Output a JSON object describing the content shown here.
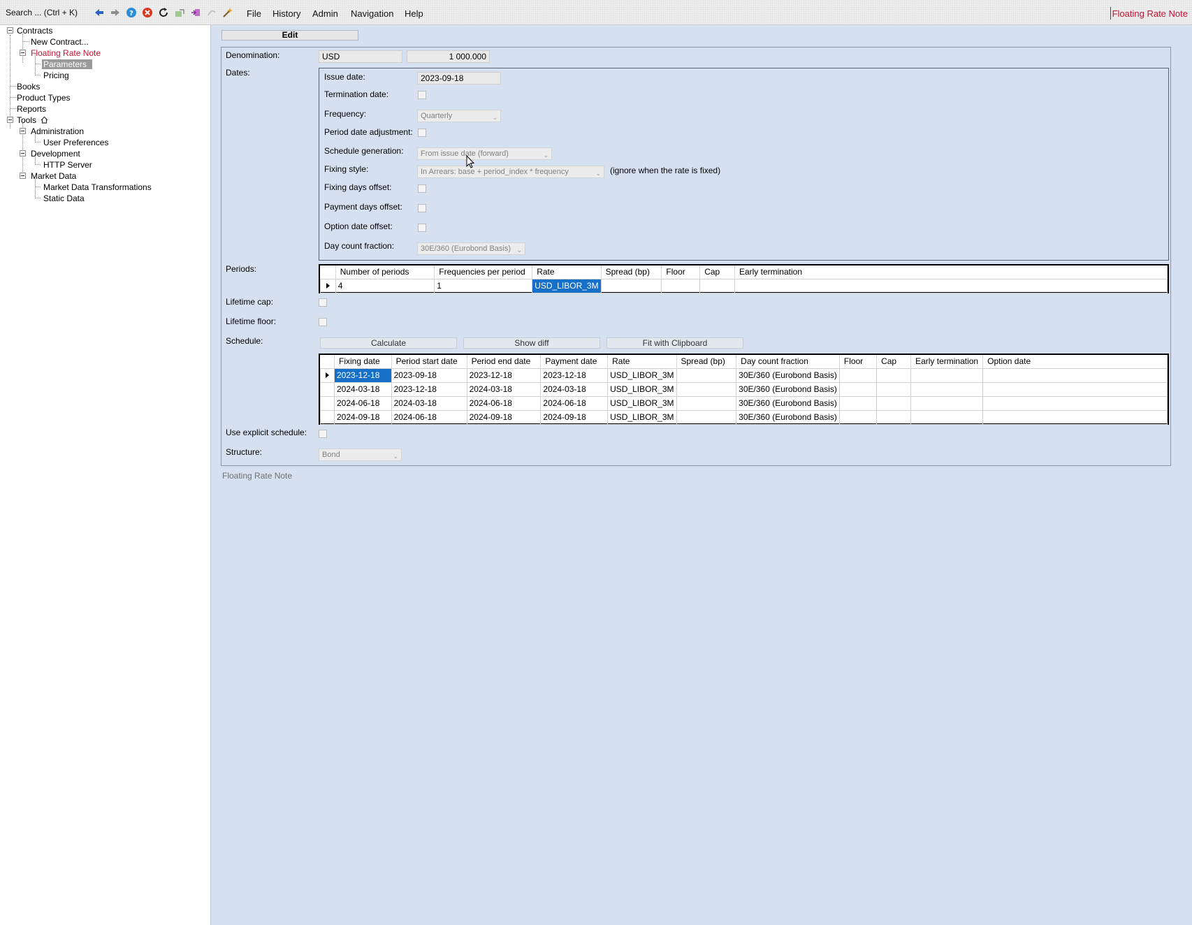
{
  "topbar": {
    "search_label": "Search ... (Ctrl + K)",
    "menu": [
      "File",
      "History",
      "Admin",
      "Navigation",
      "Help"
    ],
    "window_title": "Floating Rate Note",
    "icons": [
      "arrow-left-icon",
      "arrow-right-icon",
      "help-icon",
      "stop-icon",
      "refresh-icon",
      "export-icon",
      "import-icon",
      "forward-gray-icon",
      "wand-icon"
    ]
  },
  "tree": {
    "contracts": "Contracts",
    "new_contract": "New Contract...",
    "floating_rate_note": "Floating Rate Note",
    "parameters": "Parameters",
    "pricing": "Pricing",
    "books": "Books",
    "product_types": "Product Types",
    "reports": "Reports",
    "tools": "Tools",
    "administration": "Administration",
    "user_preferences": "User Preferences",
    "development": "Development",
    "http_server": "HTTP Server",
    "market_data": "Market Data",
    "market_data_transformations": "Market Data Transformations",
    "static_data": "Static Data"
  },
  "edit": {
    "tab_label": "Edit",
    "denomination_label": "Denomination:",
    "denomination_currency": "USD",
    "denomination_amount": "1 000.000",
    "dates_label": "Dates:",
    "issue_date_label": "Issue date:",
    "issue_date_value": "2023-09-18",
    "termination_date_label": "Termination date:",
    "frequency_label": "Frequency:",
    "frequency_value": "Quarterly",
    "period_date_adjustment_label": "Period date adjustment:",
    "schedule_generation_label": "Schedule generation:",
    "schedule_generation_value": "From issue date (forward)",
    "fixing_style_label": "Fixing style:",
    "fixing_style_value": "In Arrears: base + period_index * frequency",
    "fixing_style_note": "(ignore when the rate is fixed)",
    "fixing_days_offset_label": "Fixing days offset:",
    "payment_days_offset_label": "Payment days offset:",
    "option_date_offset_label": "Option date offset:",
    "day_count_fraction_label": "Day count fraction:",
    "day_count_fraction_value": "30E/360 (Eurobond Basis)",
    "periods_label": "Periods:",
    "lifetime_cap_label": "Lifetime cap:",
    "lifetime_floor_label": "Lifetime floor:",
    "schedule_label": "Schedule:",
    "calculate_button": "Calculate",
    "show_diff_button": "Show diff",
    "fit_clipboard_button": "Fit with Clipboard",
    "use_explicit_schedule_label": "Use explicit schedule:",
    "structure_label": "Structure:",
    "structure_value": "Bond",
    "footer_label": "Floating Rate Note"
  },
  "periods_grid": {
    "columns": [
      "Number of periods",
      "Frequencies per period",
      "Rate",
      "Spread (bp)",
      "Floor",
      "Cap",
      "Early termination"
    ],
    "rows": [
      [
        "4",
        "1",
        "USD_LIBOR_3M",
        "",
        "",
        "",
        ""
      ]
    ]
  },
  "schedule_grid": {
    "columns": [
      "Fixing date",
      "Period start date",
      "Period end date",
      "Payment date",
      "Rate",
      "Spread (bp)",
      "Day count fraction",
      "Floor",
      "Cap",
      "Early termination",
      "Option date"
    ],
    "rows": [
      [
        "2023-12-18",
        "2023-09-18",
        "2023-12-18",
        "2023-12-18",
        "USD_LIBOR_3M",
        "",
        "30E/360 (Eurobond Basis)",
        "",
        "",
        "",
        ""
      ],
      [
        "2024-03-18",
        "2023-12-18",
        "2024-03-18",
        "2024-03-18",
        "USD_LIBOR_3M",
        "",
        "30E/360 (Eurobond Basis)",
        "",
        "",
        "",
        ""
      ],
      [
        "2024-06-18",
        "2024-03-18",
        "2024-06-18",
        "2024-06-18",
        "USD_LIBOR_3M",
        "",
        "30E/360 (Eurobond Basis)",
        "",
        "",
        "",
        ""
      ],
      [
        "2024-09-18",
        "2024-06-18",
        "2024-09-18",
        "2024-09-18",
        "USD_LIBOR_3M",
        "",
        "30E/360 (Eurobond Basis)",
        "",
        "",
        "",
        ""
      ]
    ]
  },
  "colors": {
    "accent_red": "#c41230",
    "selection_blue": "#1670c8",
    "background": "#d5e1f0"
  }
}
